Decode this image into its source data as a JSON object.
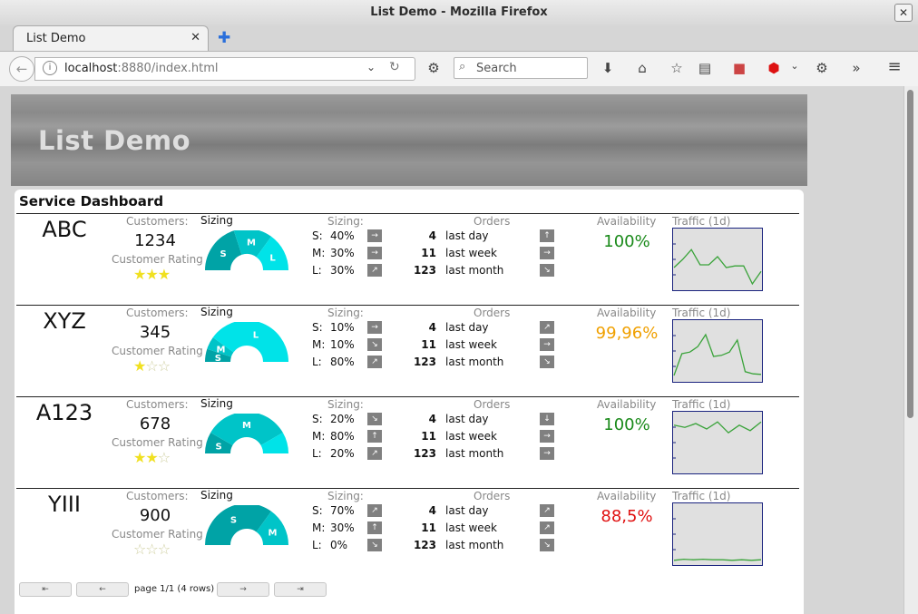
{
  "window": {
    "title": "List Demo - Mozilla Firefox"
  },
  "tab": {
    "label": "List Demo"
  },
  "nav": {
    "url_host": "localhost",
    "url_rest": ":8880/index.html",
    "search_placeholder": "Search",
    "overflow": "»"
  },
  "page": {
    "banner_title": "List Demo",
    "panel_title": "Service Dashboard",
    "labels": {
      "customers": "Customers:",
      "customer_rating": "Customer Rating",
      "sizing_title": "Sizing",
      "sizing_header": "Sizing:",
      "orders": "Orders",
      "availability": "Availability",
      "traffic": "Traffic (1d)"
    },
    "rows": [
      {
        "name": "ABC",
        "customers": "1234",
        "rating": 3,
        "sizing": [
          {
            "k": "S:",
            "v": "40%",
            "arrow": "→"
          },
          {
            "k": "M:",
            "v": "30%",
            "arrow": "→"
          },
          {
            "k": "L:",
            "v": "30%",
            "arrow": "↗"
          }
        ],
        "orders": [
          {
            "n": "4",
            "label": "last day",
            "arrow": "↑"
          },
          {
            "n": "11",
            "label": "last week",
            "arrow": "→"
          },
          {
            "n": "123",
            "label": "last month",
            "arrow": "↘"
          }
        ],
        "availability": "100%",
        "availability_color": "#1a8a1a",
        "gauge_labels": [
          "S",
          "M",
          "L"
        ],
        "traffic": [
          0.65,
          0.5,
          0.32,
          0.6,
          0.6,
          0.45,
          0.65,
          0.62,
          0.62,
          0.95,
          0.72
        ]
      },
      {
        "name": "XYZ",
        "customers": "345",
        "rating": 1,
        "sizing": [
          {
            "k": "S:",
            "v": "10%",
            "arrow": "→"
          },
          {
            "k": "M:",
            "v": "10%",
            "arrow": "↘"
          },
          {
            "k": "L:",
            "v": "80%",
            "arrow": "↗"
          }
        ],
        "orders": [
          {
            "n": "4",
            "label": "last day",
            "arrow": "↗"
          },
          {
            "n": "11",
            "label": "last week",
            "arrow": "→"
          },
          {
            "n": "123",
            "label": "last month",
            "arrow": "↘"
          }
        ],
        "availability": "99,96%",
        "availability_color": "#f0a000",
        "gauge_labels": [
          "S",
          "M",
          "L"
        ],
        "traffic": [
          0.95,
          0.55,
          0.52,
          0.42,
          0.2,
          0.6,
          0.58,
          0.52,
          0.3,
          0.88,
          0.92,
          0.93
        ]
      },
      {
        "name": "A123",
        "customers": "678",
        "rating": 2,
        "sizing": [
          {
            "k": "S:",
            "v": "20%",
            "arrow": "↘"
          },
          {
            "k": "M:",
            "v": "80%",
            "arrow": "↑"
          },
          {
            "k": "L:",
            "v": "20%",
            "arrow": "↗"
          }
        ],
        "orders": [
          {
            "n": "4",
            "label": "last day",
            "arrow": "↓"
          },
          {
            "n": "11",
            "label": "last week",
            "arrow": "→"
          },
          {
            "n": "123",
            "label": "last month",
            "arrow": "→"
          }
        ],
        "availability": "100%",
        "availability_color": "#1a8a1a",
        "gauge_labels": [
          "S",
          "M"
        ],
        "traffic": [
          0.18,
          0.22,
          0.15,
          0.25,
          0.12,
          0.32,
          0.18,
          0.28,
          0.12
        ]
      },
      {
        "name": "YIII",
        "customers": "900",
        "rating": 0,
        "sizing": [
          {
            "k": "S:",
            "v": "70%",
            "arrow": "↗"
          },
          {
            "k": "M:",
            "v": "30%",
            "arrow": "↑"
          },
          {
            "k": "L:",
            "v": "0%",
            "arrow": "↘"
          }
        ],
        "orders": [
          {
            "n": "4",
            "label": "last day",
            "arrow": "↗"
          },
          {
            "n": "11",
            "label": "last week",
            "arrow": "↗"
          },
          {
            "n": "123",
            "label": "last month",
            "arrow": "↘"
          }
        ],
        "availability": "88,5%",
        "availability_color": "#e01010",
        "gauge_labels": [
          "S",
          "M"
        ],
        "traffic": [
          0.98,
          0.96,
          0.97,
          0.96,
          0.97,
          0.97,
          0.98,
          0.97,
          0.98,
          0.97
        ]
      }
    ],
    "pager": {
      "first": "⇤",
      "prev": "←",
      "text": "page 1/1 (4 rows)",
      "next": "→",
      "last": "⇥"
    }
  },
  "colors": {
    "gauge_dark": "#00a3a6",
    "gauge_mid": "#00c4c8",
    "gauge_light": "#00e3e8",
    "spark_line": "#3aa33a",
    "star_on": "#f0e020"
  }
}
